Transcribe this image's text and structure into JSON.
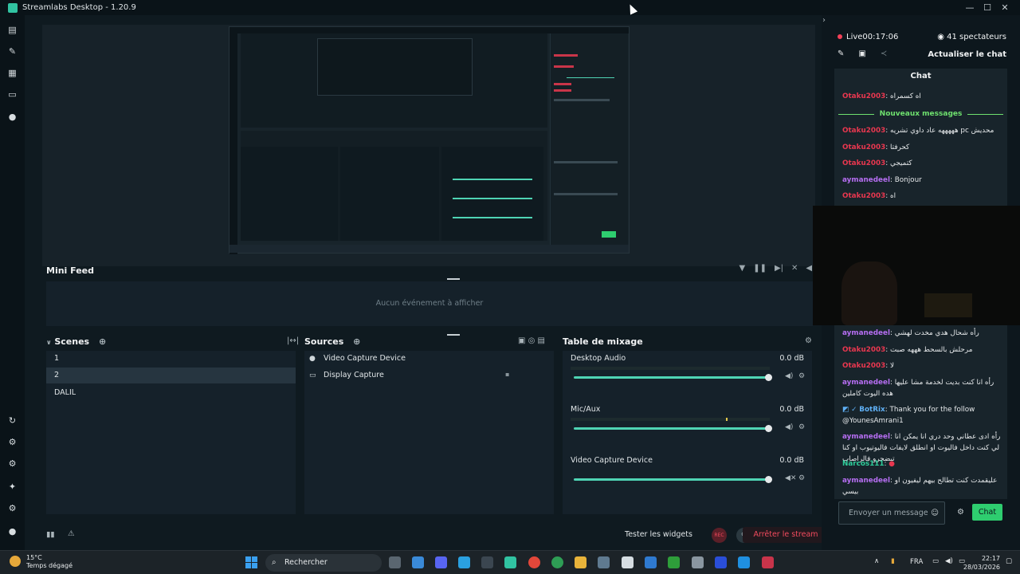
{
  "window": {
    "title": "Streamlabs Desktop - 1.20.9",
    "controls": [
      "—",
      "☐",
      "✕"
    ]
  },
  "nav": {
    "top": [
      "editor",
      "themes",
      "store",
      "layout",
      "record"
    ],
    "bottom": [
      "dashboard",
      "integrations",
      "plugins",
      "effects",
      "settings",
      "profile"
    ]
  },
  "mini_feed": {
    "title": "Mini Feed",
    "empty_text": "Aucun événement à afficher"
  },
  "scenes": {
    "title": "Scenes",
    "items": [
      "1",
      "2",
      "DALIL"
    ],
    "selected_index": 1
  },
  "sources": {
    "title": "Sources",
    "items": [
      {
        "label": "Video Capture Device",
        "icon": "camera-icon"
      },
      {
        "label": "Display Capture",
        "icon": "monitor-icon"
      }
    ]
  },
  "mixer": {
    "title": "Table de mixage",
    "channels": [
      {
        "name": "Desktop Audio",
        "db": "0.0 dB",
        "volume": 1.0
      },
      {
        "name": "Mic/Aux",
        "db": "0.0 dB",
        "volume": 1.0,
        "peak": 0.78
      },
      {
        "name": "Video Capture Device",
        "db": "0.0 dB",
        "volume": 1.0
      }
    ]
  },
  "footer": {
    "test_widgets": "Tester les widgets",
    "rec_label": "REC",
    "stop_stream": "Arrêter le stream"
  },
  "chat": {
    "live_label": "Live",
    "live_time": "00:17:06",
    "viewers": "41 spectateurs",
    "refresh": "Actualiser le chat",
    "header": "Chat",
    "new_messages": "Nouveaux messages",
    "messages": [
      {
        "user": "Otaku2003",
        "text": "اه كسمراه",
        "color": "#e8374f"
      },
      {
        "user": "Otaku2003",
        "text": "هههههه عاد داوي تشريه pc محديش",
        "color": "#e8374f"
      },
      {
        "user": "Otaku2003",
        "text": "كحرفتا",
        "color": "#e8374f"
      },
      {
        "user": "Otaku2003",
        "text": "كتميجي",
        "color": "#e8374f"
      },
      {
        "user": "aymanedeel",
        "text": "Bonjour",
        "color": "#b66ef2"
      },
      {
        "user": "Otaku2003",
        "text": "اه",
        "color": "#e8374f"
      },
      {
        "user": "aymanedeel",
        "text": "رأه شحال هدي مخدت لهشي",
        "color": "#b66ef2"
      },
      {
        "user": "Otaku2003",
        "text": "مرحلش بالسحط هههه صبت",
        "color": "#e8374f"
      },
      {
        "user": "Otaku2003",
        "text": "لا",
        "color": "#e8374f"
      },
      {
        "user": "aymanedeel",
        "text": "رأه انا كنت بديت لخدمة مشا عليها هده اليوت كاملين",
        "color": "#b66ef2"
      },
      {
        "user": "BotRix",
        "text": "Thank you for the follow @YounesAmrani1",
        "color": "#5fb0f5"
      },
      {
        "user": "aymanedeel",
        "text": "رأه ادى عطاني وحد دري انا يمكن انا لي كنت داخل فاليوت او انطلق لايفات فاليوتيوب او كنا تيضحرو فالراصاب",
        "color": "#b66ef2"
      },
      {
        "user": "Narcos111",
        "text": "",
        "color": "#2ecd9a"
      },
      {
        "user": "aymanedeel",
        "text": "عليقمدت كنت تطالح بيهم ليفيون او بيسي",
        "color": "#b66ef2"
      }
    ],
    "input_placeholder": "Envoyer un message",
    "send": "Chat"
  },
  "taskbar": {
    "weather_temp": "15°C",
    "weather_desc": "Temps dégagé",
    "search": "Rechercher",
    "lang": "FRA",
    "time": "22:17",
    "date": "28/03/2026"
  }
}
